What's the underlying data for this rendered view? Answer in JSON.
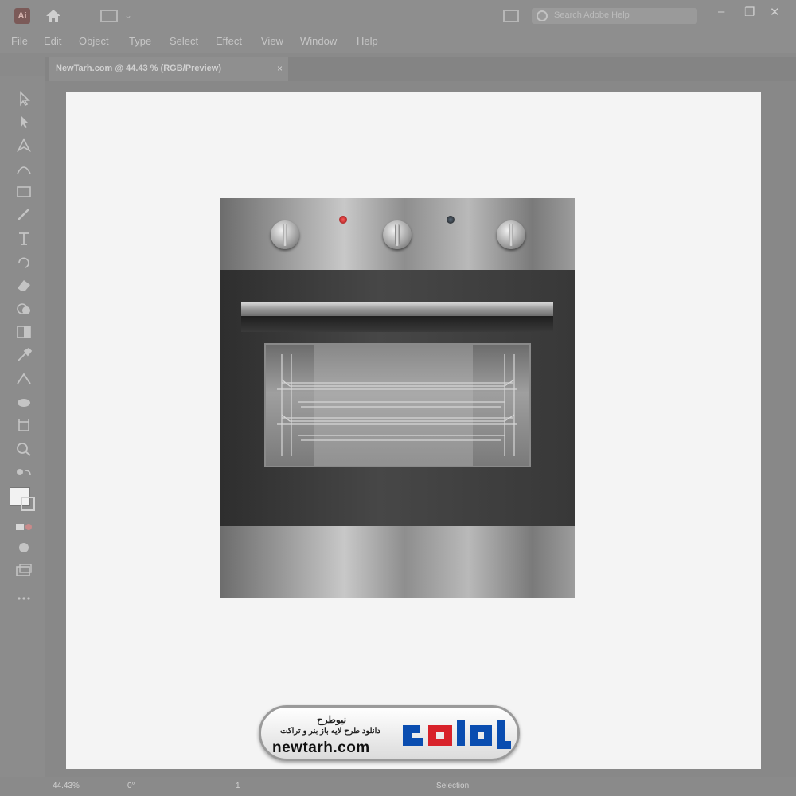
{
  "app": {
    "logo_text": "Ai",
    "search_placeholder": "Search Adobe Help"
  },
  "menu": [
    "File",
    "Edit",
    "Object",
    "Type",
    "Select",
    "Effect",
    "View",
    "Window",
    "Help"
  ],
  "document_tab": {
    "label": "NewTarh.com @ 44.43 % (RGB/Preview)",
    "close": "×"
  },
  "window_controls": [
    "–",
    "❐",
    "✕"
  ],
  "status": {
    "zoom": "44.43%",
    "rotation": "0°",
    "artboard": "1",
    "tool": "Selection"
  },
  "watermark": {
    "title": "نیوطرح",
    "subtitle": "دانلود طرح لایه باز بنر و تراکت",
    "url": "newtarh.com",
    "logo_text": "نیوطرح",
    "logo_color_primary": "#0a4db0",
    "logo_color_accent": "#d8222a"
  },
  "colors": {
    "indicator_red": "#d8222a",
    "artboard": "#f4f4f4"
  }
}
